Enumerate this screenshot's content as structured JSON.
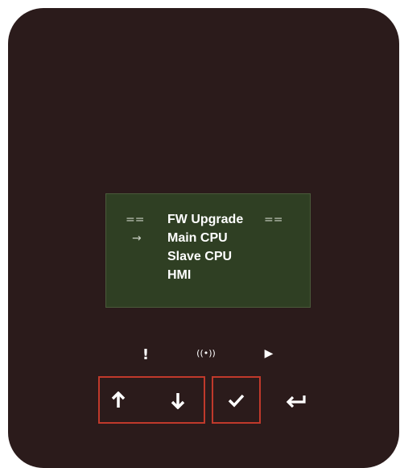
{
  "display": {
    "header_left": "==",
    "header_title": "FW Upgrade",
    "header_right": "==",
    "cursor": "→",
    "items": [
      "Main CPU",
      "Slave CPU",
      "HMI"
    ]
  },
  "indicators": {
    "alarm": "!",
    "communication": "((•))",
    "run": "▶"
  },
  "keys": {
    "up": "up-arrow",
    "down": "down-arrow",
    "confirm": "check",
    "enter": "return"
  },
  "colors": {
    "housing": "#2b1b1b",
    "lcd_background": "#2f3f23",
    "highlight": "#c0392b"
  }
}
